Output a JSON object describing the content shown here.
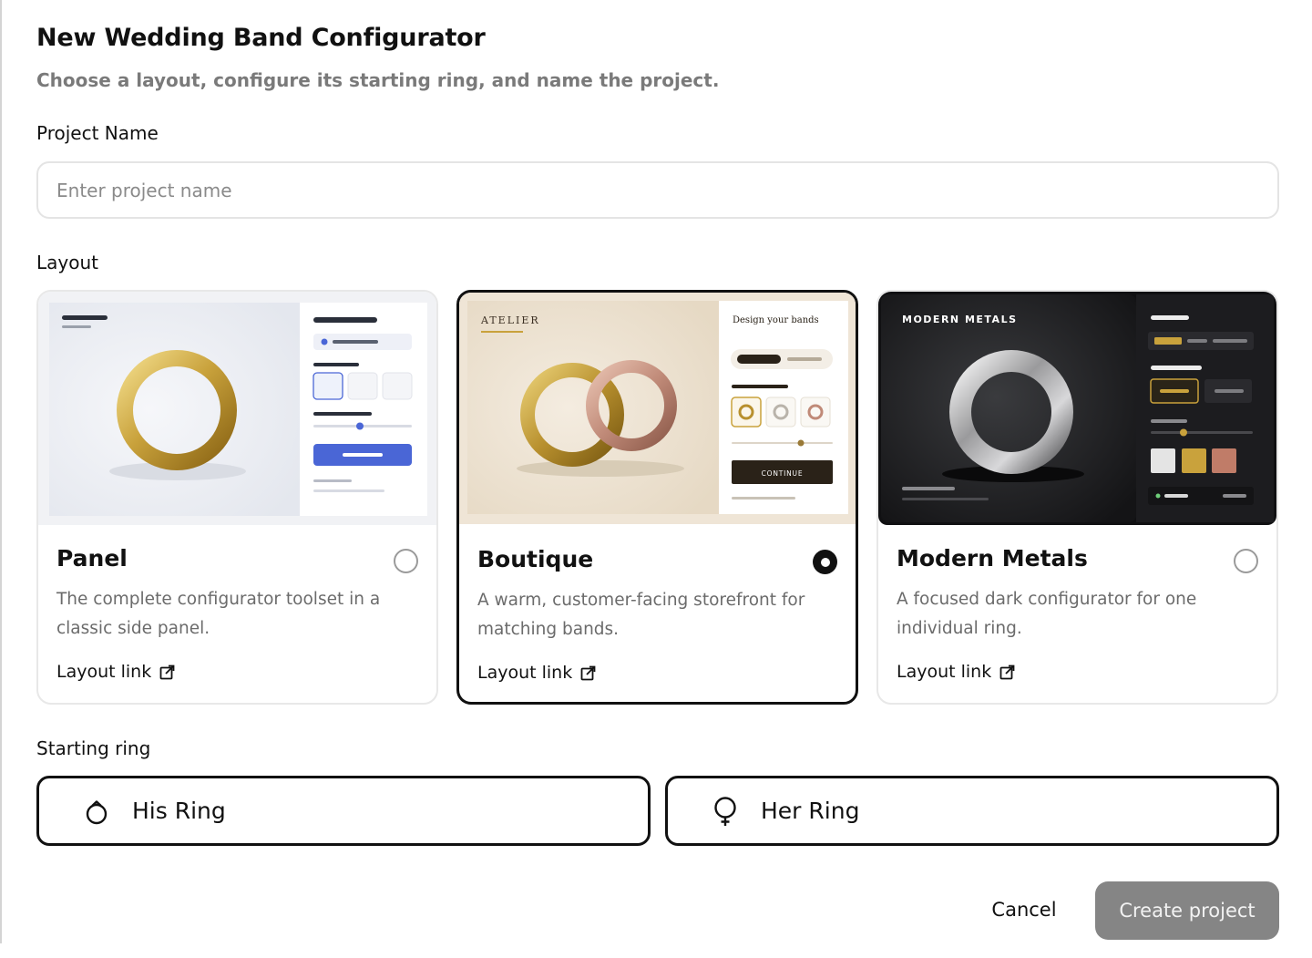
{
  "dialog": {
    "title": "New Wedding Band Configurator",
    "subtitle": "Choose a layout, configure its starting ring, and name the project."
  },
  "project_name": {
    "label": "Project Name",
    "placeholder": "Enter project name",
    "value": ""
  },
  "layout": {
    "label": "Layout",
    "selected": "Boutique",
    "cards": [
      {
        "title": "Panel",
        "description": "The complete configurator toolset in a classic side panel.",
        "link_label": "Layout link",
        "selected": false
      },
      {
        "title": "Boutique",
        "description": "A warm, customer-facing storefront for matching bands.",
        "link_label": "Layout link",
        "selected": true,
        "preview": {
          "brand": "ATELIER",
          "panel_heading": "Design your bands",
          "button_label": "CONTINUE"
        }
      },
      {
        "title": "Modern Metals",
        "description": "A focused dark configurator for one individual ring.",
        "link_label": "Layout link",
        "selected": false,
        "preview": {
          "brand": "MODERN METALS"
        }
      }
    ]
  },
  "starting_ring": {
    "label": "Starting ring",
    "options": [
      {
        "label": "His Ring",
        "icon": "male-symbol-icon"
      },
      {
        "label": "Her Ring",
        "icon": "female-symbol-icon"
      }
    ]
  },
  "actions": {
    "cancel": "Cancel",
    "create": "Create project"
  },
  "colors": {
    "selected_border": "#111111",
    "create_button_bg": "#858585",
    "panel_accent_blue": "#4a66d6",
    "gold": "#c9a23c",
    "rose_gold": "#c08a78"
  }
}
